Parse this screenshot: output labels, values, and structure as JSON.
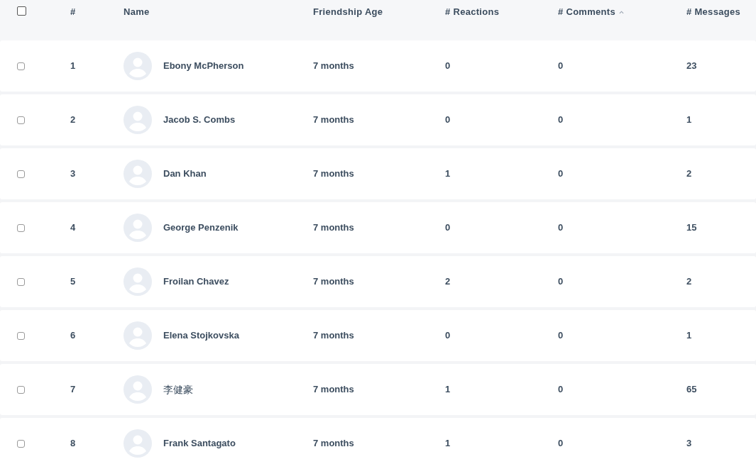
{
  "table": {
    "select_all": {
      "checked": false
    },
    "columns": [
      {
        "label": "#",
        "sorted": false
      },
      {
        "label": "Name",
        "sorted": false
      },
      {
        "label": "Friendship Age",
        "sorted": false
      },
      {
        "label": "# Reactions",
        "sorted": false
      },
      {
        "label": "# Comments",
        "sorted": true
      },
      {
        "label": "# Messages",
        "sorted": false
      }
    ],
    "rows": [
      {
        "checked": false,
        "index": "1",
        "name": "Ebony McPherson",
        "age": "7 months",
        "reactions": "0",
        "comments": "0",
        "messages": "23"
      },
      {
        "checked": false,
        "index": "2",
        "name": "Jacob S. Combs",
        "age": "7 months",
        "reactions": "0",
        "comments": "0",
        "messages": "1"
      },
      {
        "checked": false,
        "index": "3",
        "name": "Dan Khan",
        "age": "7 months",
        "reactions": "1",
        "comments": "0",
        "messages": "2"
      },
      {
        "checked": false,
        "index": "4",
        "name": "George Penzenik",
        "age": "7 months",
        "reactions": "0",
        "comments": "0",
        "messages": "15"
      },
      {
        "checked": false,
        "index": "5",
        "name": "Froilan Chavez",
        "age": "7 months",
        "reactions": "2",
        "comments": "0",
        "messages": "2"
      },
      {
        "checked": false,
        "index": "6",
        "name": "Elena Stojkovska",
        "age": "7 months",
        "reactions": "0",
        "comments": "0",
        "messages": "1"
      },
      {
        "checked": false,
        "index": "7",
        "name": "李健豪",
        "age": "7 months",
        "reactions": "1",
        "comments": "0",
        "messages": "65"
      },
      {
        "checked": false,
        "index": "8",
        "name": "Frank Santagato",
        "age": "7 months",
        "reactions": "1",
        "comments": "0",
        "messages": "3"
      }
    ]
  }
}
